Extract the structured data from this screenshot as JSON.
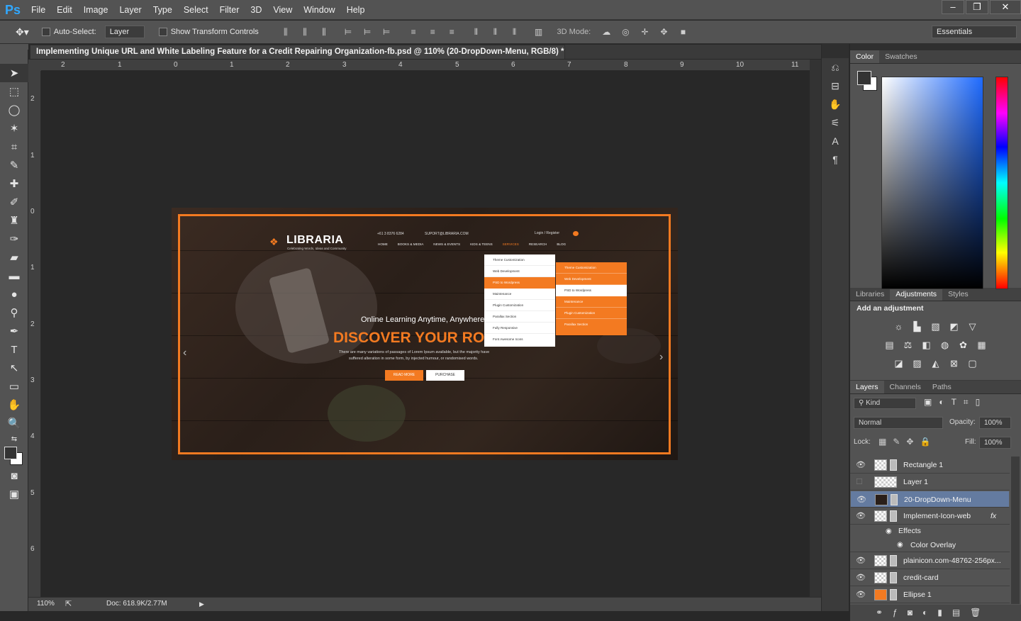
{
  "app": {
    "logo": "Ps"
  },
  "menu": [
    "File",
    "Edit",
    "Image",
    "Layer",
    "Type",
    "Select",
    "Filter",
    "3D",
    "View",
    "Window",
    "Help"
  ],
  "window_controls": {
    "minimize": "–",
    "restore": "❐",
    "close": "✕"
  },
  "options": {
    "auto_select_label": "Auto-Select:",
    "auto_select_value": "Layer",
    "show_transform_label": "Show Transform Controls",
    "mode_3d_label": "3D Mode:",
    "workspace": "Essentials"
  },
  "document": {
    "tab_title": "Implementing Unique URL and White Labeling Feature for a Credit Repairing Organization-fb.psd @ 110% (20-DropDown-Menu, RGB/8) *",
    "close": "×"
  },
  "ruler_top": [
    "2",
    "1",
    "0",
    "1",
    "2",
    "3",
    "4",
    "5",
    "6",
    "7",
    "8",
    "9",
    "10",
    "11"
  ],
  "ruler_left": [
    "2",
    "1",
    "0",
    "1",
    "2",
    "3",
    "4",
    "5",
    "6"
  ],
  "status": {
    "zoom": "110%",
    "doc": "Doc: 618.9K/2.77M"
  },
  "artwork": {
    "logo": "LIBRARIA",
    "logo_tagline": "Celebrating Words, Ideas and Community",
    "phone": "+61 3 8376 6284",
    "email": "SUPORT@LIBRARIA.COM",
    "login": "Login / Register",
    "nav": [
      "HOME",
      "BOOKS & MEDIA",
      "NEWS & EVENTS",
      "KIDS & TEENS",
      "SERVICES",
      "RESEARCH",
      "BLOG"
    ],
    "dropdown_left": [
      "Theme Customization",
      "Web Development",
      "PSD to Wordpress",
      "Maintenance",
      "Plugin Customization",
      "Parallax Section",
      "Fully Responsive",
      "Font Awesome Icons"
    ],
    "dropdown_right": [
      "Theme Customization",
      "Web Development",
      "PSD to Wordpress",
      "Maintenance",
      "Plugin Customization",
      "Parallax Section"
    ],
    "hero_sub": "Online Learning Anytime, Anywhere",
    "hero_title": "DISCOVER YOUR RO",
    "hero_text_1": "There are many variations of passages of Lorem Ipsum available, but the majority have",
    "hero_text_2": "suffered alteration in some form, by injected humour, or randomised words.",
    "btn_read": "READ MORE",
    "btn_purchase": "PURCHASE",
    "accent": "#f37a21"
  },
  "color_panel": {
    "tabs": [
      "Color",
      "Swatches"
    ]
  },
  "adjust_panel": {
    "tabs": [
      "Libraries",
      "Adjustments",
      "Styles"
    ],
    "heading": "Add an adjustment"
  },
  "layers_panel": {
    "tabs": [
      "Layers",
      "Channels",
      "Paths"
    ],
    "kind": "Kind",
    "blend": "Normal",
    "opacity_label": "Opacity:",
    "opacity": "100%",
    "lock_label": "Lock:",
    "fill_label": "Fill:",
    "fill": "100%",
    "layers": [
      {
        "name": "Rectangle 1",
        "visible": true
      },
      {
        "name": "Layer 1",
        "visible": false
      },
      {
        "name": "20-DropDown-Menu",
        "visible": true,
        "selected": true
      },
      {
        "name": "Implement-Icon-web",
        "visible": true,
        "fx": "fx"
      },
      {
        "name": "Effects",
        "visible": true
      },
      {
        "name": "Color Overlay",
        "visible": true
      },
      {
        "name": "plainicon.com-48762-256px...",
        "visible": true
      },
      {
        "name": "credit-card",
        "visible": true
      },
      {
        "name": "Ellipse 1",
        "visible": true
      }
    ]
  }
}
